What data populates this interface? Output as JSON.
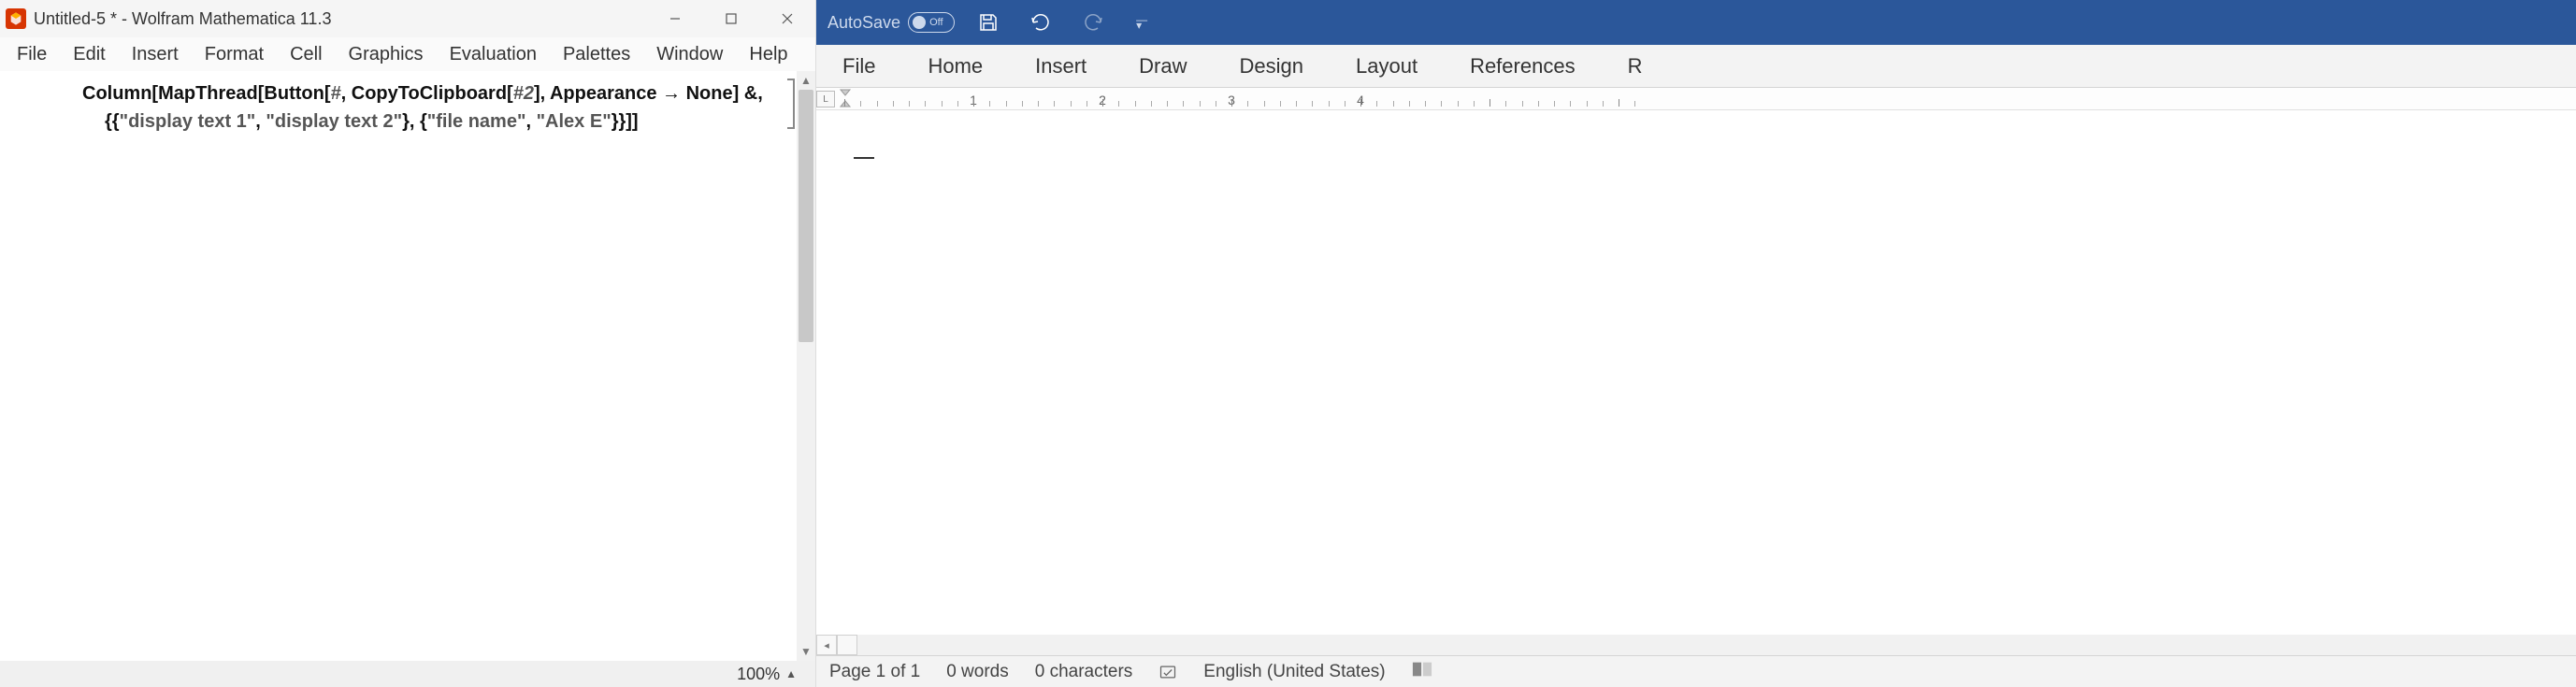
{
  "mathematica": {
    "title": "Untitled-5 * - Wolfram Mathematica 11.3",
    "menus": [
      "File",
      "Edit",
      "Insert",
      "Format",
      "Cell",
      "Graphics",
      "Evaluation",
      "Palettes",
      "Window",
      "Help"
    ],
    "code_line1_a": "Column[MapThread[Button[",
    "code_line1_slot1": "#",
    "code_line1_b": ", CopyToClipboard[",
    "code_line1_slot2": "#2",
    "code_line1_c": "], Appearance → None] &,",
    "code_line2_a": "{{",
    "code_line2_s1": "\"display text 1\"",
    "code_line2_b": ", ",
    "code_line2_s2": "\"display text 2\"",
    "code_line2_c": "}, {",
    "code_line2_s3": "\"file name\"",
    "code_line2_d": ", ",
    "code_line2_s4": "\"Alex E\"",
    "code_line2_e": "}}]]",
    "zoom": "100%"
  },
  "word": {
    "autosave_label": "AutoSave",
    "autosave_state": "Off",
    "ribbon_tabs": [
      "File",
      "Home",
      "Insert",
      "Draw",
      "Design",
      "Layout",
      "References",
      "R"
    ],
    "ruler_numbers": [
      "1",
      "2",
      "3",
      "4"
    ],
    "status": {
      "page": "Page 1 of 1",
      "words": "0 words",
      "chars": "0 characters",
      "lang": "English (United States)"
    }
  }
}
